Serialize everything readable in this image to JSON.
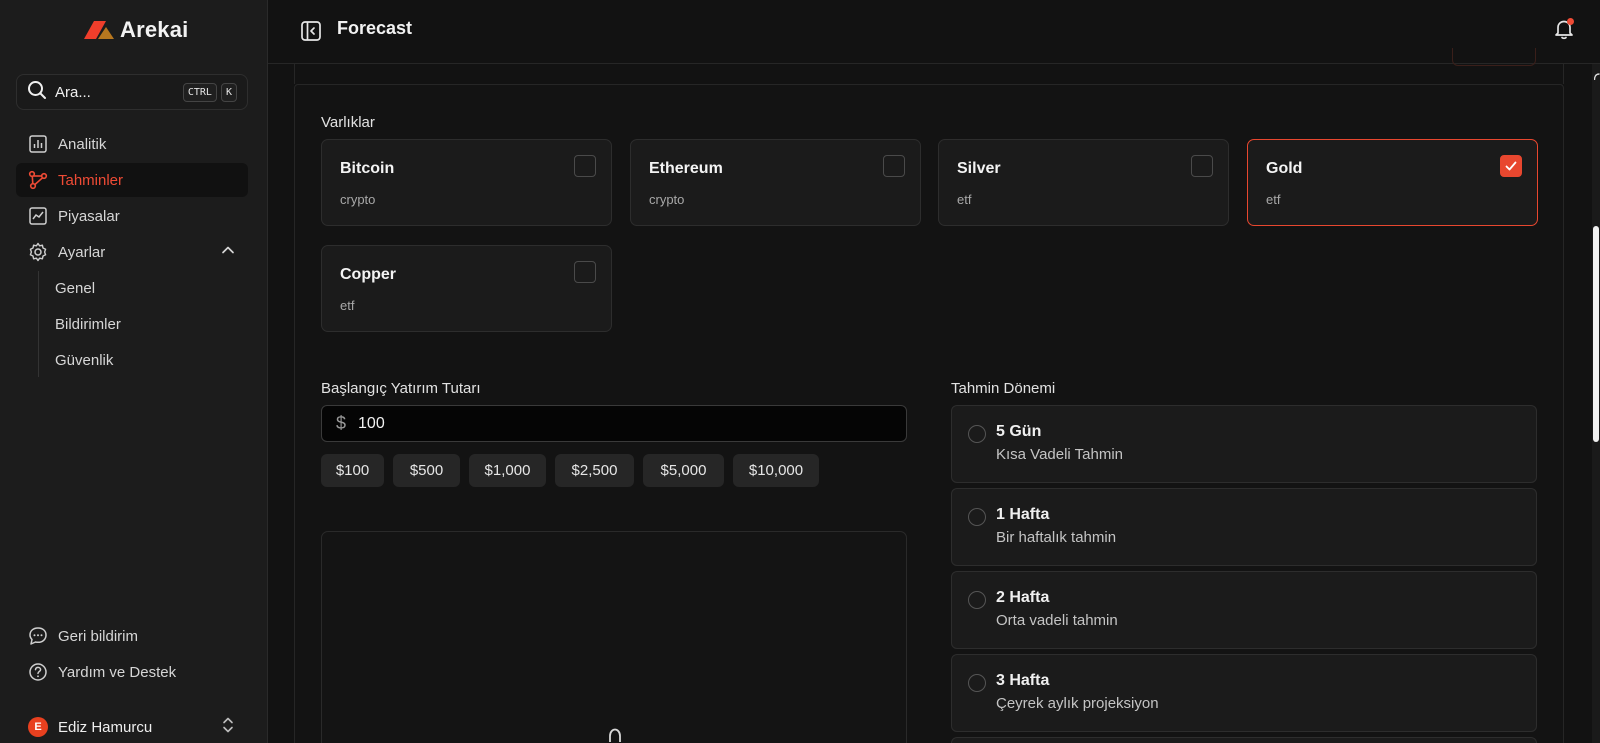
{
  "brand": {
    "name": "Arekai",
    "accent": "#ef4b35"
  },
  "search": {
    "label": "Ara...",
    "shortcut_keys": [
      "CTRL",
      "K"
    ]
  },
  "nav": {
    "items": [
      {
        "label": "Analitik",
        "icon": "bar-chart-icon",
        "active": false
      },
      {
        "label": "Tahminler",
        "icon": "network-icon",
        "active": true
      },
      {
        "label": "Piyasalar",
        "icon": "line-chart-icon",
        "active": false
      },
      {
        "label": "Ayarlar",
        "icon": "gear-icon",
        "active": false,
        "expanded": true
      }
    ],
    "settings_sub": [
      {
        "label": "Genel"
      },
      {
        "label": "Bildirimler"
      },
      {
        "label": "Güvenlik"
      }
    ]
  },
  "footer_nav": [
    {
      "label": "Geri bildirim",
      "icon": "chat-icon"
    },
    {
      "label": "Yardım ve Destek",
      "icon": "help-icon"
    }
  ],
  "user": {
    "name": "Ediz Hamurcu",
    "initial": "E"
  },
  "header": {
    "title": "Forecast",
    "notification_dot": true
  },
  "assets": {
    "label": "Varlıklar",
    "items": [
      {
        "name": "Bitcoin",
        "type": "crypto",
        "selected": false
      },
      {
        "name": "Ethereum",
        "type": "crypto",
        "selected": false
      },
      {
        "name": "Silver",
        "type": "etf",
        "selected": false
      },
      {
        "name": "Gold",
        "type": "etf",
        "selected": true
      },
      {
        "name": "Copper",
        "type": "etf",
        "selected": false
      }
    ]
  },
  "investment": {
    "label": "Başlangıç Yatırım Tutarı",
    "currency_symbol": "$",
    "value": "100",
    "presets": [
      "$100",
      "$500",
      "$1,000",
      "$2,500",
      "$5,000",
      "$10,000"
    ]
  },
  "period": {
    "label": "Tahmin Dönemi",
    "options": [
      {
        "title": "5 Gün",
        "description": "Kısa Vadeli Tahmin"
      },
      {
        "title": "1 Hafta",
        "description": "Bir haftalık tahmin"
      },
      {
        "title": "2 Hafta",
        "description": "Orta vadeli tahmin"
      },
      {
        "title": "3 Hafta",
        "description": "Çeyrek aylık projeksiyon"
      }
    ]
  }
}
